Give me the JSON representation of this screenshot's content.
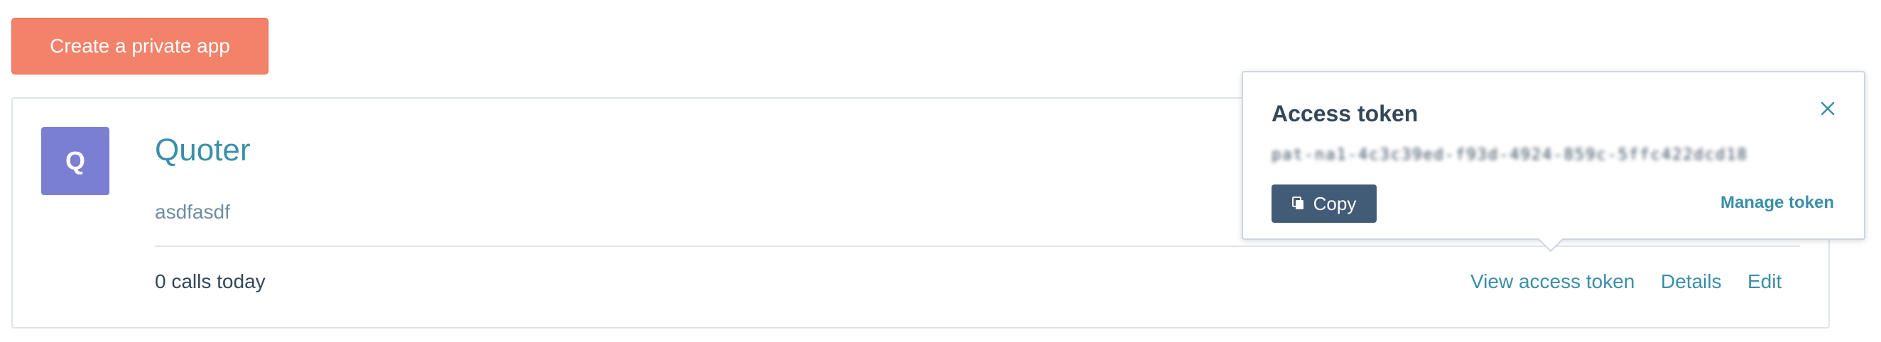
{
  "toolbar": {
    "create_label": "Create a private app"
  },
  "app": {
    "logo_letter": "Q",
    "name": "Quoter",
    "description": "asdfasdf",
    "calls": "0 calls today",
    "actions": {
      "view_token": "View access token",
      "details": "Details",
      "edit": "Edit"
    }
  },
  "popover": {
    "title": "Access token",
    "token": "pat-na1-4c3c39ed-f93d-4924-859c-5ffc422dcd18",
    "copy_label": "Copy",
    "manage_label": "Manage token"
  },
  "colors": {
    "primary_button": "#f2826a",
    "logo_bg": "#7b7fd4",
    "link": "#3b8fa8",
    "copy_button": "#425b76"
  },
  "icons": {
    "close": "close-icon",
    "copy": "copy-icon"
  }
}
